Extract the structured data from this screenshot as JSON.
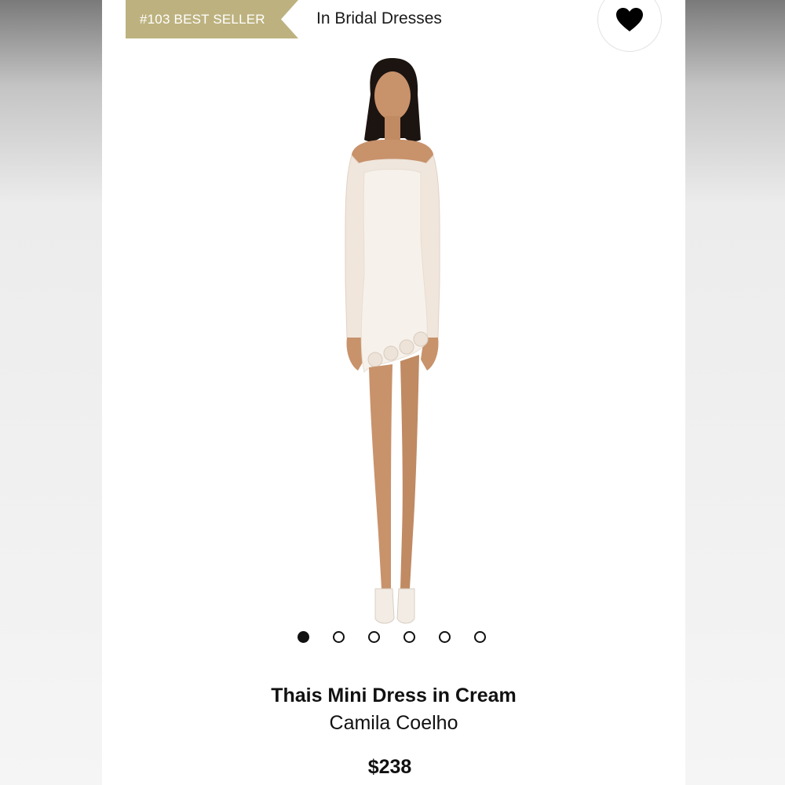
{
  "badge": {
    "label": "#103 BEST SELLER",
    "color": "#bdb27f"
  },
  "category": "In Bridal Dresses",
  "favorite": {
    "icon": "heart-icon"
  },
  "product": {
    "title": "Thais Mini Dress in Cream",
    "brand": "Camila Coelho",
    "price": "$238",
    "image_alt": "model wearing cream off-shoulder mini dress"
  },
  "carousel": {
    "count": 6,
    "active_index": 1
  }
}
